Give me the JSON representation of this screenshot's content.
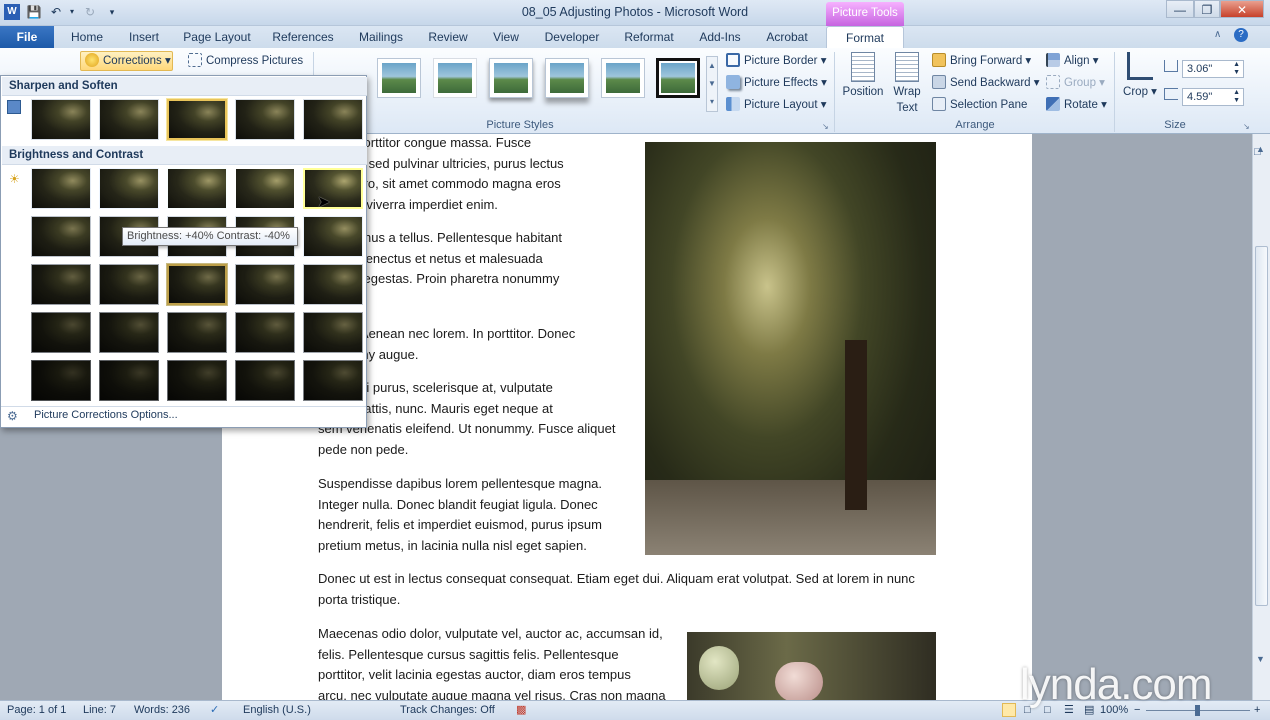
{
  "window": {
    "title": "08_05 Adjusting Photos - Microsoft Word",
    "contextual_group": "Picture Tools"
  },
  "tabs": [
    "File",
    "Home",
    "Insert",
    "Page Layout",
    "References",
    "Mailings",
    "Review",
    "View",
    "Developer",
    "Reformat",
    "Add-Ins",
    "Acrobat",
    "Format"
  ],
  "ribbon": {
    "adjust": {
      "corrections": "Corrections",
      "compress": "Compress Pictures"
    },
    "picture_styles": {
      "label": "Picture Styles"
    },
    "style_options": {
      "border": "Picture Border",
      "effects": "Picture Effects",
      "layout": "Picture Layout"
    },
    "arrange": {
      "label": "Arrange",
      "position": "Position",
      "wrap": "Wrap",
      "wrap2": "Text",
      "bring_forward": "Bring Forward",
      "send_backward": "Send Backward",
      "selection_pane": "Selection Pane",
      "align": "Align",
      "group": "Group",
      "rotate": "Rotate"
    },
    "size": {
      "label": "Size",
      "crop": "Crop",
      "height": "3.06\"",
      "width": "4.59\""
    }
  },
  "gallery": {
    "sharpen_header": "Sharpen and Soften",
    "brightness_header": "Brightness and Contrast",
    "options": "Picture Corrections Options...",
    "tooltip": "Brightness: +40% Contrast: -40%"
  },
  "document": {
    "p1": [
      "cenas porttitor congue massa. Fusce",
      ", magna sed pulvinar ultricies, purus lectus",
      "ada libero, sit amet commodo magna eros",
      "a. Nunc viverra imperdiet enim."
    ],
    "p2": [
      "st. Vivamus a tellus. Pellentesque habitant",
      "istique senectus et netus et malesuada",
      "c turpis egestas. Proin pharetra nonummy"
    ],
    "p3": [
      "et orci.  Aenean nec lorem. In porttitor. Donec",
      "nonummy augue."
    ],
    "p4": [
      "disse dui purus, scelerisque at, vulputate",
      "etium mattis, nunc. Mauris eget neque at",
      "sem venenatis eleifend. Ut nonummy. Fusce aliquet",
      "pede non pede."
    ],
    "p5": [
      "Suspendisse dapibus lorem pellentesque magna.",
      "Integer nulla. Donec blandit feugiat ligula. Donec",
      "hendrerit, felis et imperdiet euismod, purus ipsum",
      "pretium metus, in lacinia  nulla nisl eget sapien."
    ],
    "p6": [
      "Donec ut est in lectus consequat consequat. Etiam eget dui. Aliquam erat volutpat. Sed at lorem in nunc",
      "porta tristique."
    ],
    "p7": [
      "Maecenas odio dolor, vulputate vel, auctor ac, accumsan id,",
      "felis. Pellentesque cursus sagittis felis. Pellentesque",
      "porttitor, velit lacinia  egestas auctor, diam eros tempus",
      "arcu, nec vulputate augue magna vel risus. Cras non magna"
    ]
  },
  "status": {
    "page": "Page: 1 of 1",
    "line": "Line: 7",
    "words": "Words: 236",
    "lang": "English (U.S.)",
    "track": "Track Changes: Off",
    "zoom": "100%"
  },
  "watermark": "lynda.com"
}
